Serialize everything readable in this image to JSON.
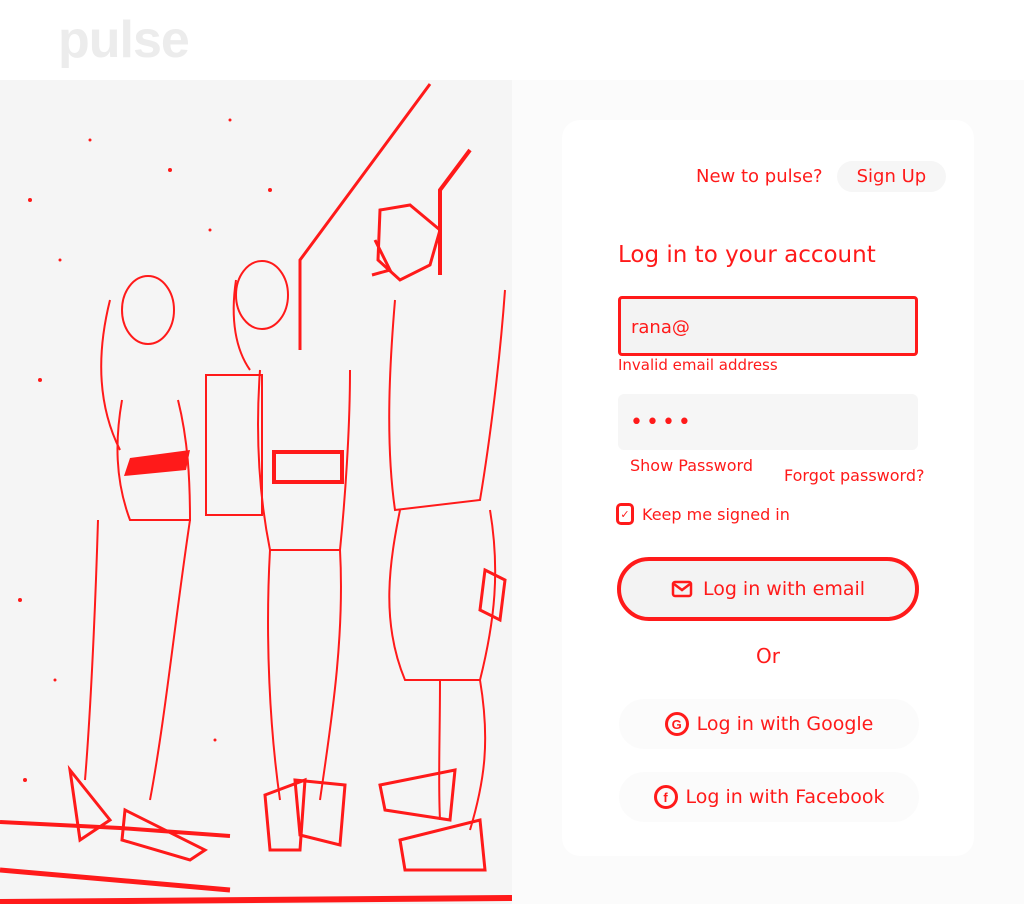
{
  "brand": {
    "logo": "pulse"
  },
  "signup": {
    "prompt": "New to pulse?",
    "button": "Sign Up"
  },
  "login": {
    "heading": "Log in to your account",
    "email_value": "rana@",
    "email_error": "Invalid email address",
    "password_value": "••••",
    "show_password": "Show Password",
    "forgot_password": "Forgot password?",
    "keep_signed_in": "Keep me signed in",
    "email_button": "Log in with email",
    "or": "Or",
    "google_button": "Log in with Google",
    "facebook_button": "Log in with Facebook"
  },
  "icons": {
    "email": "envelope-icon",
    "google": "google-icon",
    "facebook": "facebook-icon",
    "checkbox": "checkbox-icon"
  },
  "colors": {
    "accent": "#ff1a1a",
    "field_bg": "#f3f3f3",
    "logo": "#ececec"
  }
}
